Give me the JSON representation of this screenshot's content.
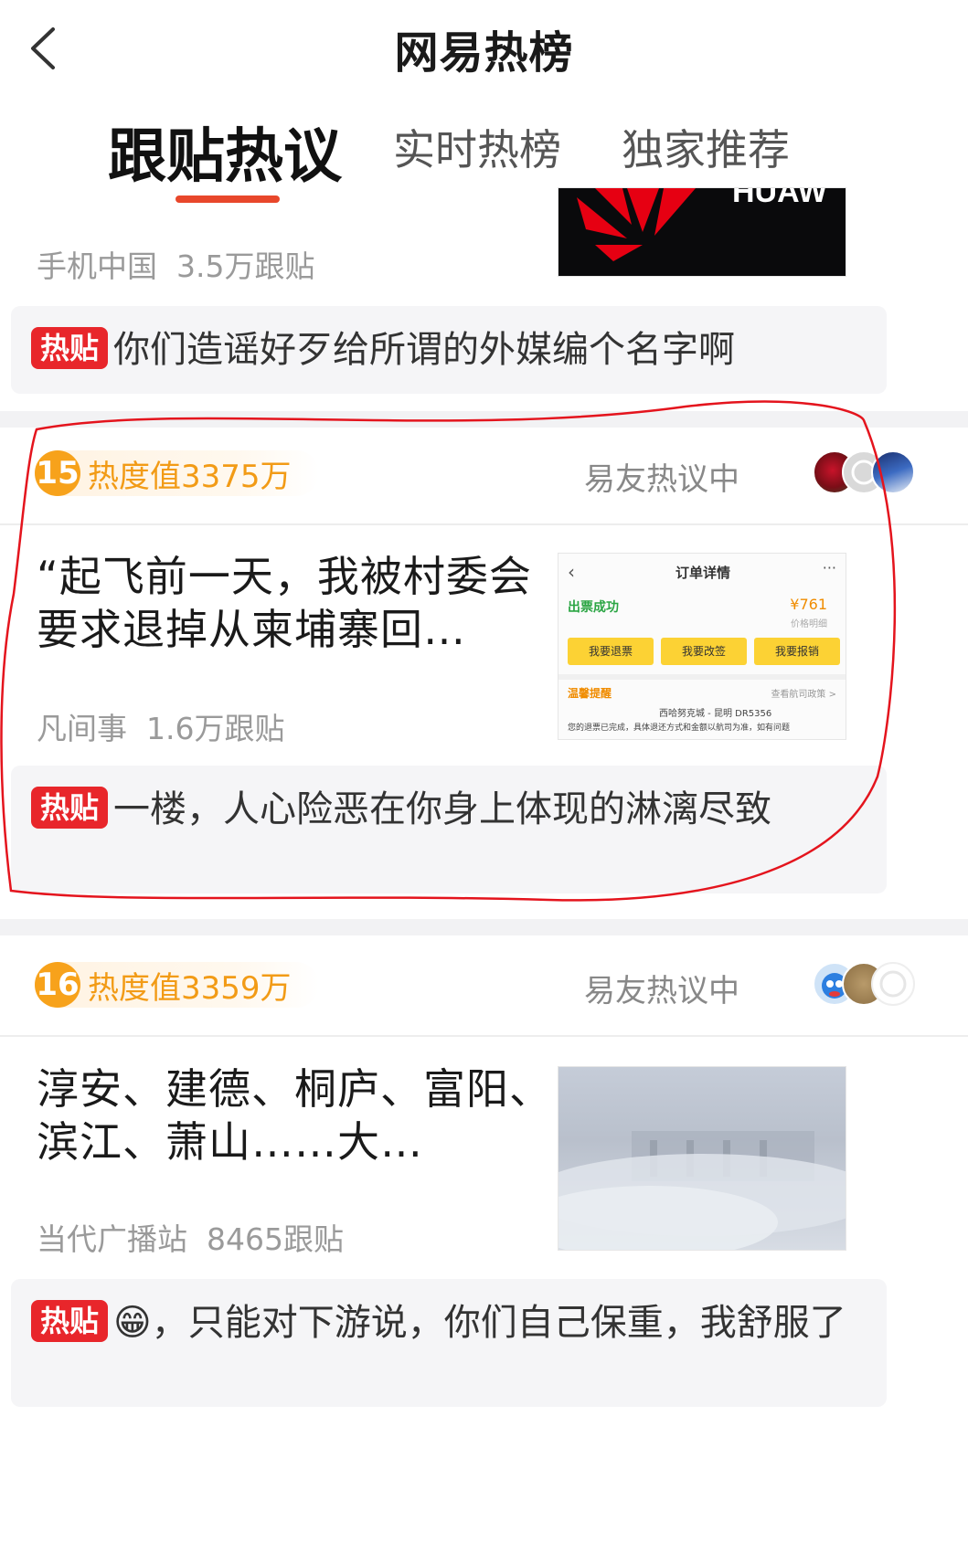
{
  "header": {
    "title": "网易热榜",
    "back_icon": "chevron-left-icon"
  },
  "tabs": [
    {
      "label": "跟贴热议",
      "active": true
    },
    {
      "label": "实时热榜",
      "active": false
    },
    {
      "label": "独家推荐",
      "active": false
    }
  ],
  "accent_color": "#e8472b",
  "items": [
    {
      "source": "手机中国",
      "comments": "3.5万跟贴",
      "thumbnail": "huawei-logo-image",
      "hot_comment": {
        "badge": "热贴",
        "text": "你们造谣好歹给所谓的外媒编个名字啊"
      }
    },
    {
      "rank": "15",
      "heat": "热度值3375万",
      "discussing": "易友热议中",
      "headline": "“起飞前一天，我被村委会要求退掉从柬埔寨回…",
      "source": "凡间事",
      "comments": "1.6万跟贴",
      "thumbnail_text": {
        "title": "订单详情",
        "status": "出票成功",
        "price": "¥761",
        "price_detail": "价格明细",
        "buttons": [
          "我要退票",
          "我要改签",
          "我要报销"
        ],
        "notice": "温馨提醒",
        "notice_link": "查看航司政策 >",
        "route": "西哈努克城 - 昆明 DR5356",
        "message": "您的退票已完成，具体退还方式和金额以航司为准，如有问题"
      },
      "hot_comment": {
        "badge": "热贴",
        "text": "一楼，人心险恶在你身上体现的淋漓尽致"
      }
    },
    {
      "rank": "16",
      "heat": "热度值3359万",
      "discussing": "易友热议中",
      "headline": "淳安、建德、桐庐、富阳、滨江、萧山……大…",
      "source": "当代广播站",
      "comments": "8465跟贴",
      "thumbnail": "foggy-dam-image",
      "hot_comment": {
        "badge": "热贴",
        "emoji": "😁",
        "text": "，只能对下游说，你们自己保重，我舒服了"
      }
    }
  ]
}
